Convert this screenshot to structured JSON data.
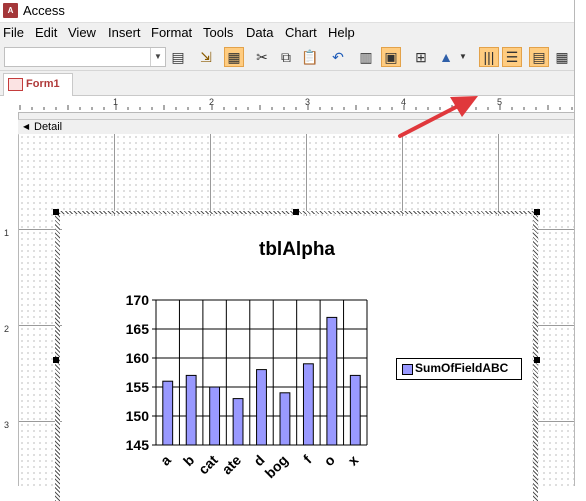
{
  "window": {
    "title": "Access",
    "app_icon": "access-app-icon"
  },
  "menu": [
    "File",
    "Edit",
    "View",
    "Insert",
    "Format",
    "Tools",
    "Data",
    "Chart",
    "Help"
  ],
  "toolbar": {
    "object_select_value": "",
    "icons": [
      "properties-icon",
      "import-icon",
      "datasheet-icon",
      "cut-icon",
      "copy-icon",
      "paste-icon",
      "undo-icon",
      "view-datasheet-icon",
      "view-chart-icon",
      "table-icon",
      "chart-type-icon",
      "chart-type-dropdown-icon",
      "by-row-icon",
      "by-column-icon",
      "legend-icon",
      "data-table-icon",
      "more-icon"
    ],
    "active": [
      "by-row-icon",
      "by-column-icon",
      "legend-icon"
    ]
  },
  "tab": {
    "label": "Form1",
    "icon": "form-icon"
  },
  "ruler": {
    "marks": [
      "1",
      "2",
      "3",
      "4",
      "5"
    ]
  },
  "vruler": {
    "marks": [
      "1",
      "2",
      "3"
    ]
  },
  "section": {
    "label": "Detail"
  },
  "annotation": {
    "color": "#e0383c"
  },
  "chart_data": {
    "type": "bar",
    "title": "tblAlpha",
    "categories": [
      "a",
      "b",
      "cat",
      "ate",
      "d",
      "bog",
      "f",
      "o",
      "x"
    ],
    "series": [
      {
        "name": "SumOfFieldABC",
        "values": [
          156,
          157,
          155,
          153,
          158,
          154,
          159,
          167,
          157
        ],
        "color": "#9999ff"
      }
    ],
    "ylim": [
      145,
      170
    ],
    "yticks": [
      "145",
      "150",
      "155",
      "160",
      "165",
      "170"
    ],
    "grid": true,
    "legend_position": "right"
  }
}
